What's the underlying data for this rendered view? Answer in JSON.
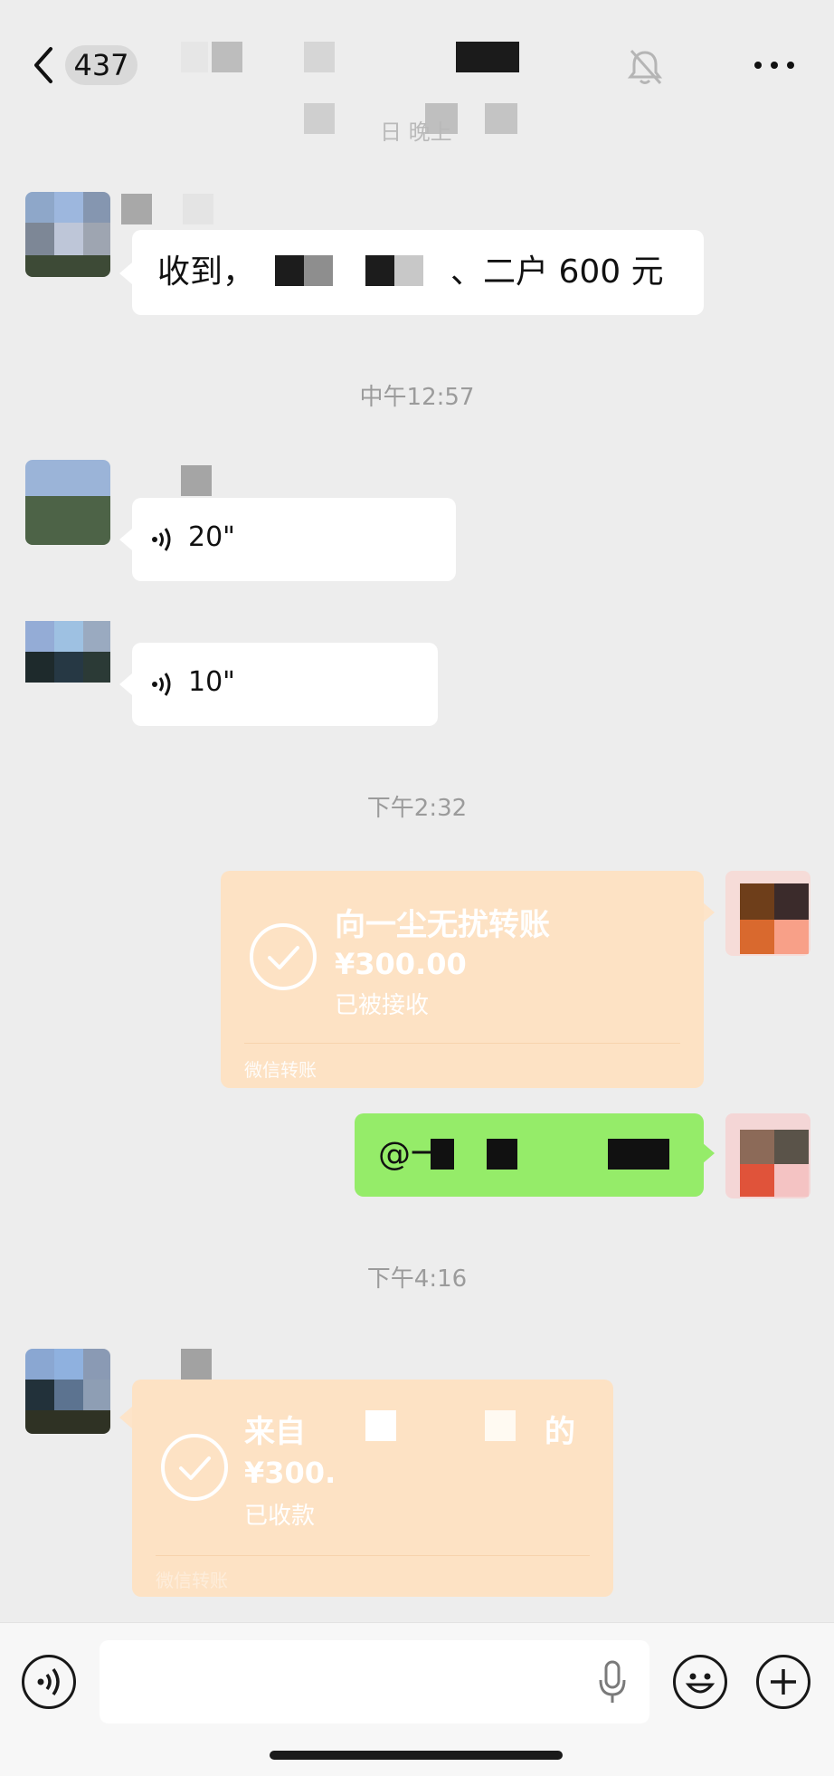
{
  "header": {
    "unread_count": "437"
  },
  "hidden_line": "日 晚上",
  "messages": {
    "m1_text": "收到，",
    "m1_text_suffix": "、二户 600 元",
    "time1": "中午12:57",
    "voice1": "20\"",
    "voice2": "10\"",
    "time2": "下午2:32",
    "transfer1": {
      "title": "向一尘无扰转账",
      "amount": "¥300.00",
      "status": "已被接收",
      "footer": "微信转账"
    },
    "green_msg": "@一",
    "time3": "下午4:16",
    "transfer2": {
      "title_prefix": "来自 ",
      "title_suffix": "的",
      "amount": "¥300.",
      "status": "已收款",
      "footer": "微信转账"
    }
  },
  "icons": {
    "back": "chevron-left-icon",
    "mute": "bell-off-icon",
    "more": "more-icon",
    "voice_mode": "voice-icon",
    "mic": "mic-icon",
    "emoji": "emoji-icon",
    "plus": "plus-icon"
  },
  "colors": {
    "background": "#ededed",
    "green_bubble": "#95ec69",
    "transfer_bubble": "#fde2c4"
  }
}
